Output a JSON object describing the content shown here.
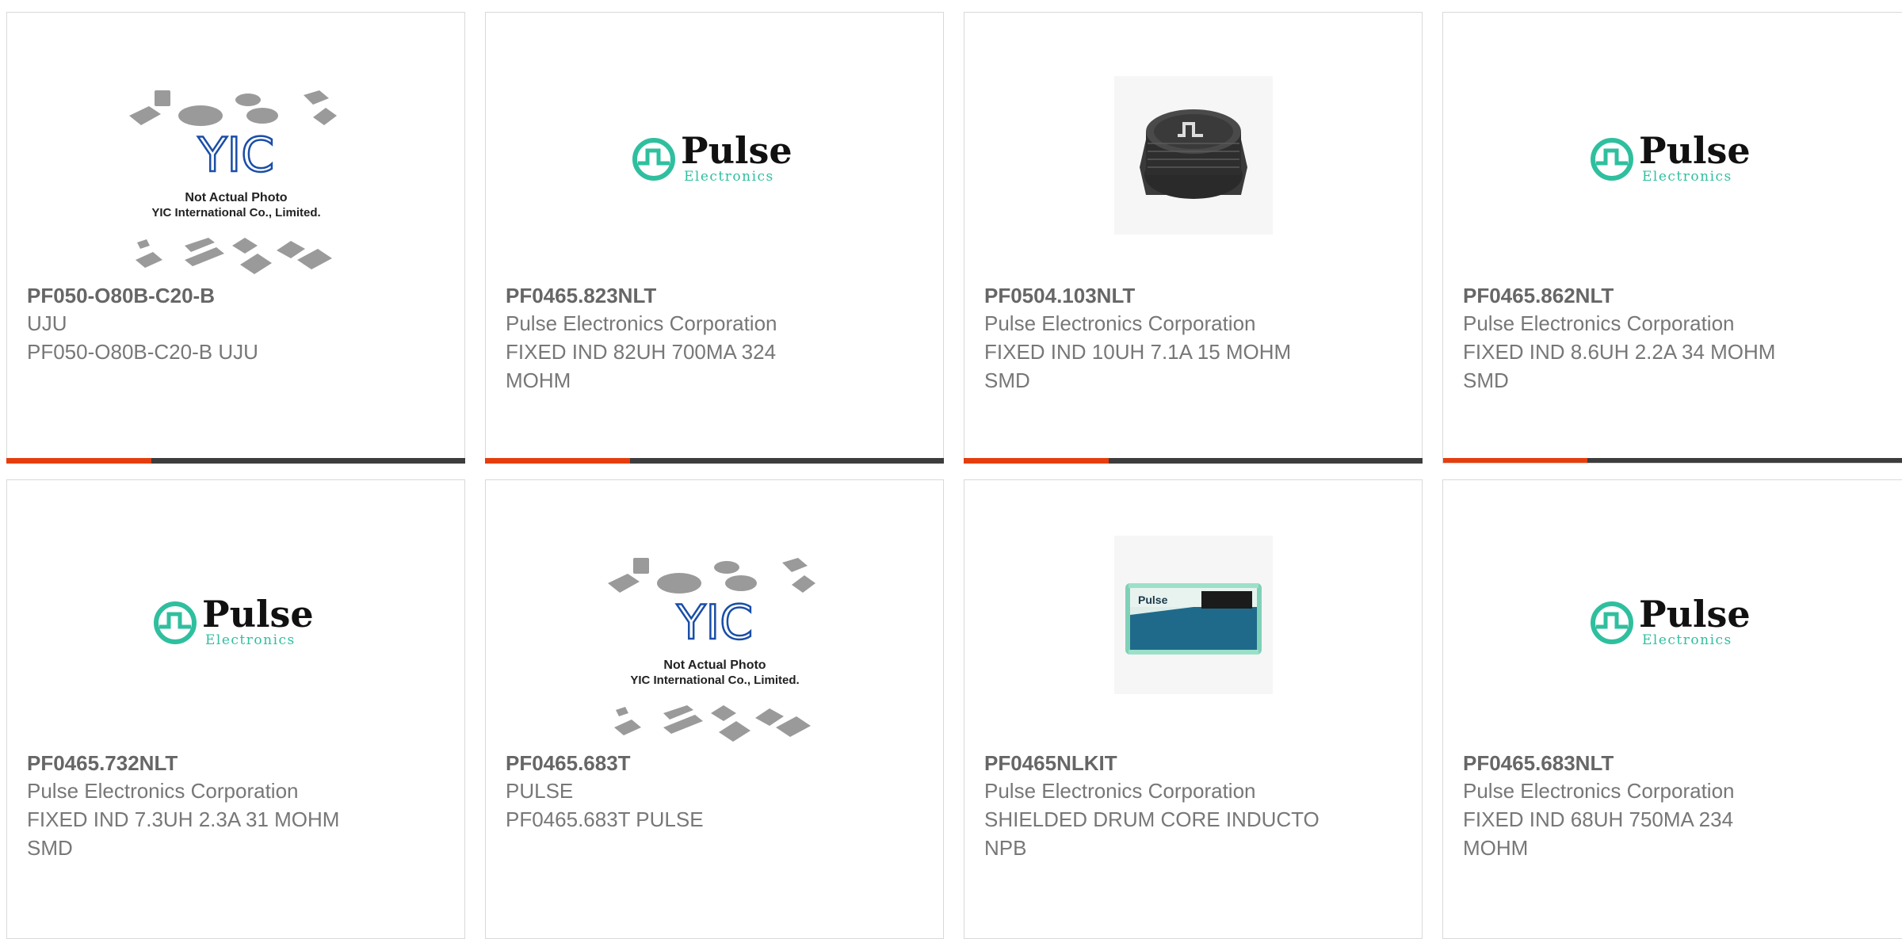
{
  "colors": {
    "accent": "#e53e0e",
    "bar": "#3d3d3d",
    "pulse_teal": "#2fbf9f",
    "yic_blue": "#1a4ea8"
  },
  "logos": {
    "pulse": {
      "name": "Pulse",
      "sub": "Electronics"
    },
    "yic": {
      "mark": "YIC",
      "line1": "Not Actual Photo",
      "line2": "YIC International Co., Limited."
    }
  },
  "cards": [
    {
      "part": "PF050-O80B-C20-B",
      "mfr": "UJU",
      "desc": "PF050-O80B-C20-B UJU",
      "image": "yic-placeholder"
    },
    {
      "part": "PF0465.823NLT",
      "mfr": "Pulse Electronics Corporation",
      "desc": "FIXED IND 82UH 700MA 324 MOHM",
      "image": "pulse-logo"
    },
    {
      "part": "PF0504.103NLT",
      "mfr": "Pulse Electronics Corporation",
      "desc": "FIXED IND 10UH 7.1A 15 MOHM SMD",
      "image": "inductor-photo"
    },
    {
      "part": "PF0465.862NLT",
      "mfr": "Pulse Electronics Corporation",
      "desc": "FIXED IND 8.6UH 2.2A 34 MOHM SMD",
      "image": "pulse-logo"
    },
    {
      "part": "PF0465.732NLT",
      "mfr": "Pulse Electronics Corporation",
      "desc": "FIXED IND 7.3UH 2.3A 31 MOHM SMD",
      "image": "pulse-logo"
    },
    {
      "part": "PF0465.683T",
      "mfr": "PULSE",
      "desc": "PF0465.683T PULSE",
      "image": "yic-placeholder"
    },
    {
      "part": "PF0465NLKIT",
      "mfr": "Pulse Electronics Corporation",
      "desc": "SHIELDED DRUM CORE INDUCTO NPB",
      "image": "kit-box-photo"
    },
    {
      "part": "PF0465.683NLT",
      "mfr": "Pulse Electronics Corporation",
      "desc": "FIXED IND 68UH 750MA 234 MOHM",
      "image": "pulse-logo"
    }
  ]
}
